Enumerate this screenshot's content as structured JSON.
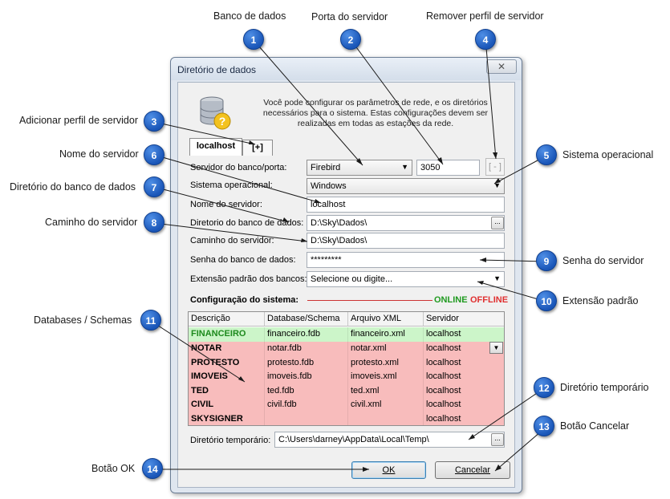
{
  "window": {
    "title": "Diretório de dados",
    "close_glyph": "✕"
  },
  "intro": "Você pode configurar os parâmetros de rede, e os diretórios necessários para o sistema. Estas configurações devem ser realizadas em todas as estações da rede.",
  "tabs": [
    {
      "label": "localhost",
      "active": true
    },
    {
      "label": "[+]",
      "active": false
    }
  ],
  "form": {
    "server_label": "Servidor do banco/porta:",
    "server_value": "Firebird",
    "port_value": "3050",
    "remove_label": "[ - ]",
    "os_label": "Sistema operacional:",
    "os_value": "Windows",
    "server_name_label": "Nome do servidor:",
    "server_name_value": "localhost",
    "db_dir_label": "Diretorio do banco de dados:",
    "db_dir_value": "D:\\Sky\\Dados\\",
    "server_path_label": "Caminho do servidor:",
    "server_path_value": "D:\\Sky\\Dados\\",
    "db_password_label": "Senha do banco de dados:",
    "db_password_value": "*********",
    "ext_label": "Extensão padrão dos bancos:",
    "ext_placeholder": "Selecione ou digite...",
    "ellipsis": "..."
  },
  "system": {
    "title": "Configuração do sistema:",
    "online": "ONLINE",
    "offline": "OFFLINE"
  },
  "grid": {
    "columns": [
      "Descrição",
      "Database/Schema",
      "Arquivo XML",
      "Servidor"
    ],
    "rows": [
      {
        "desc": "FINANCEIRO",
        "db": "financeiro.fdb",
        "xml": "financeiro.xml",
        "server": "localhost",
        "status": "online"
      },
      {
        "desc": "NOTAR",
        "db": "notar.fdb",
        "xml": "notar.xml",
        "server": "localhost",
        "status": "offline"
      },
      {
        "desc": "PROTESTO",
        "db": "protesto.fdb",
        "xml": "protesto.xml",
        "server": "localhost",
        "status": "offline"
      },
      {
        "desc": "IMOVEIS",
        "db": "imoveis.fdb",
        "xml": "imoveis.xml",
        "server": "localhost",
        "status": "offline"
      },
      {
        "desc": "TED",
        "db": "ted.fdb",
        "xml": "ted.xml",
        "server": "localhost",
        "status": "offline"
      },
      {
        "desc": "CIVIL",
        "db": "civil.fdb",
        "xml": "civil.xml",
        "server": "localhost",
        "status": "offline"
      },
      {
        "desc": "SKYSIGNER",
        "db": "",
        "xml": "",
        "server": "localhost",
        "status": "offline"
      }
    ]
  },
  "temp": {
    "label": "Diretório temporário:",
    "value": "C:\\Users\\darney\\AppData\\Local\\Temp\\"
  },
  "buttons": {
    "ok": "OK",
    "cancel": "Cancelar"
  },
  "annotations": [
    {
      "n": "1",
      "label": "Banco de dados"
    },
    {
      "n": "2",
      "label": "Porta do servidor"
    },
    {
      "n": "3",
      "label": "Adicionar perfil de servidor"
    },
    {
      "n": "4",
      "label": "Remover perfil de servidor"
    },
    {
      "n": "5",
      "label": "Sistema operacional"
    },
    {
      "n": "6",
      "label": "Nome do servidor"
    },
    {
      "n": "7",
      "label": "Diretório do banco de dados"
    },
    {
      "n": "8",
      "label": "Caminho do servidor"
    },
    {
      "n": "9",
      "label": "Senha do servidor"
    },
    {
      "n": "10",
      "label": "Extensão padrão"
    },
    {
      "n": "11",
      "label": "Databases / Schemas"
    },
    {
      "n": "12",
      "label": "Diretório temporário"
    },
    {
      "n": "13",
      "label": "Botão Cancelar"
    },
    {
      "n": "14",
      "label": "Botão OK"
    }
  ],
  "colors": {
    "badge": "#1a56b8",
    "online": "#1f9a1f",
    "offline": "#e03030",
    "row_online": "#ccf5c9",
    "row_offline": "#f8bcbc"
  }
}
